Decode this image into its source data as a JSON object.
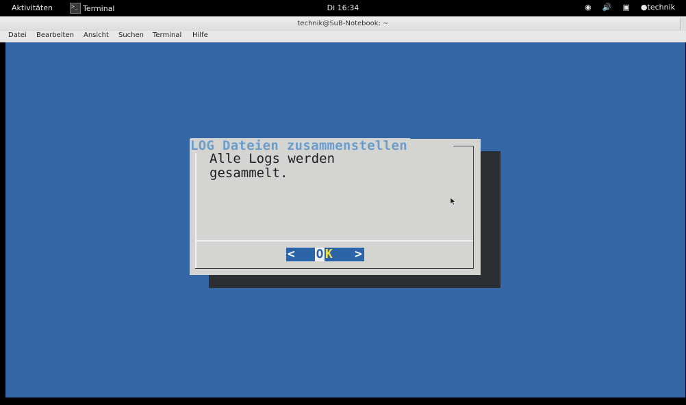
{
  "topbar": {
    "activities": "Aktivitäten",
    "app_name": "Terminal",
    "clock": "Di 16:34",
    "user": "technik"
  },
  "window": {
    "title": "technik@SuB-Notebook: ~"
  },
  "menubar": {
    "items": [
      "Datei",
      "Bearbeiten",
      "Ansicht",
      "Suchen",
      "Terminal",
      "Hilfe"
    ]
  },
  "dialog": {
    "title": "LOG Dateien zusammenstellen",
    "message": "Alle Logs werden\ngesammelt.",
    "ok_left": "<",
    "ok_o": "O",
    "ok_k": "K",
    "ok_right": ">"
  },
  "colors": {
    "terminal_bg": "#3566a6",
    "dialog_bg": "#d4d5d0",
    "title_color": "#6a9ccc",
    "button_bg": "#2d64a8",
    "hotkey_color": "#f0dc42"
  }
}
